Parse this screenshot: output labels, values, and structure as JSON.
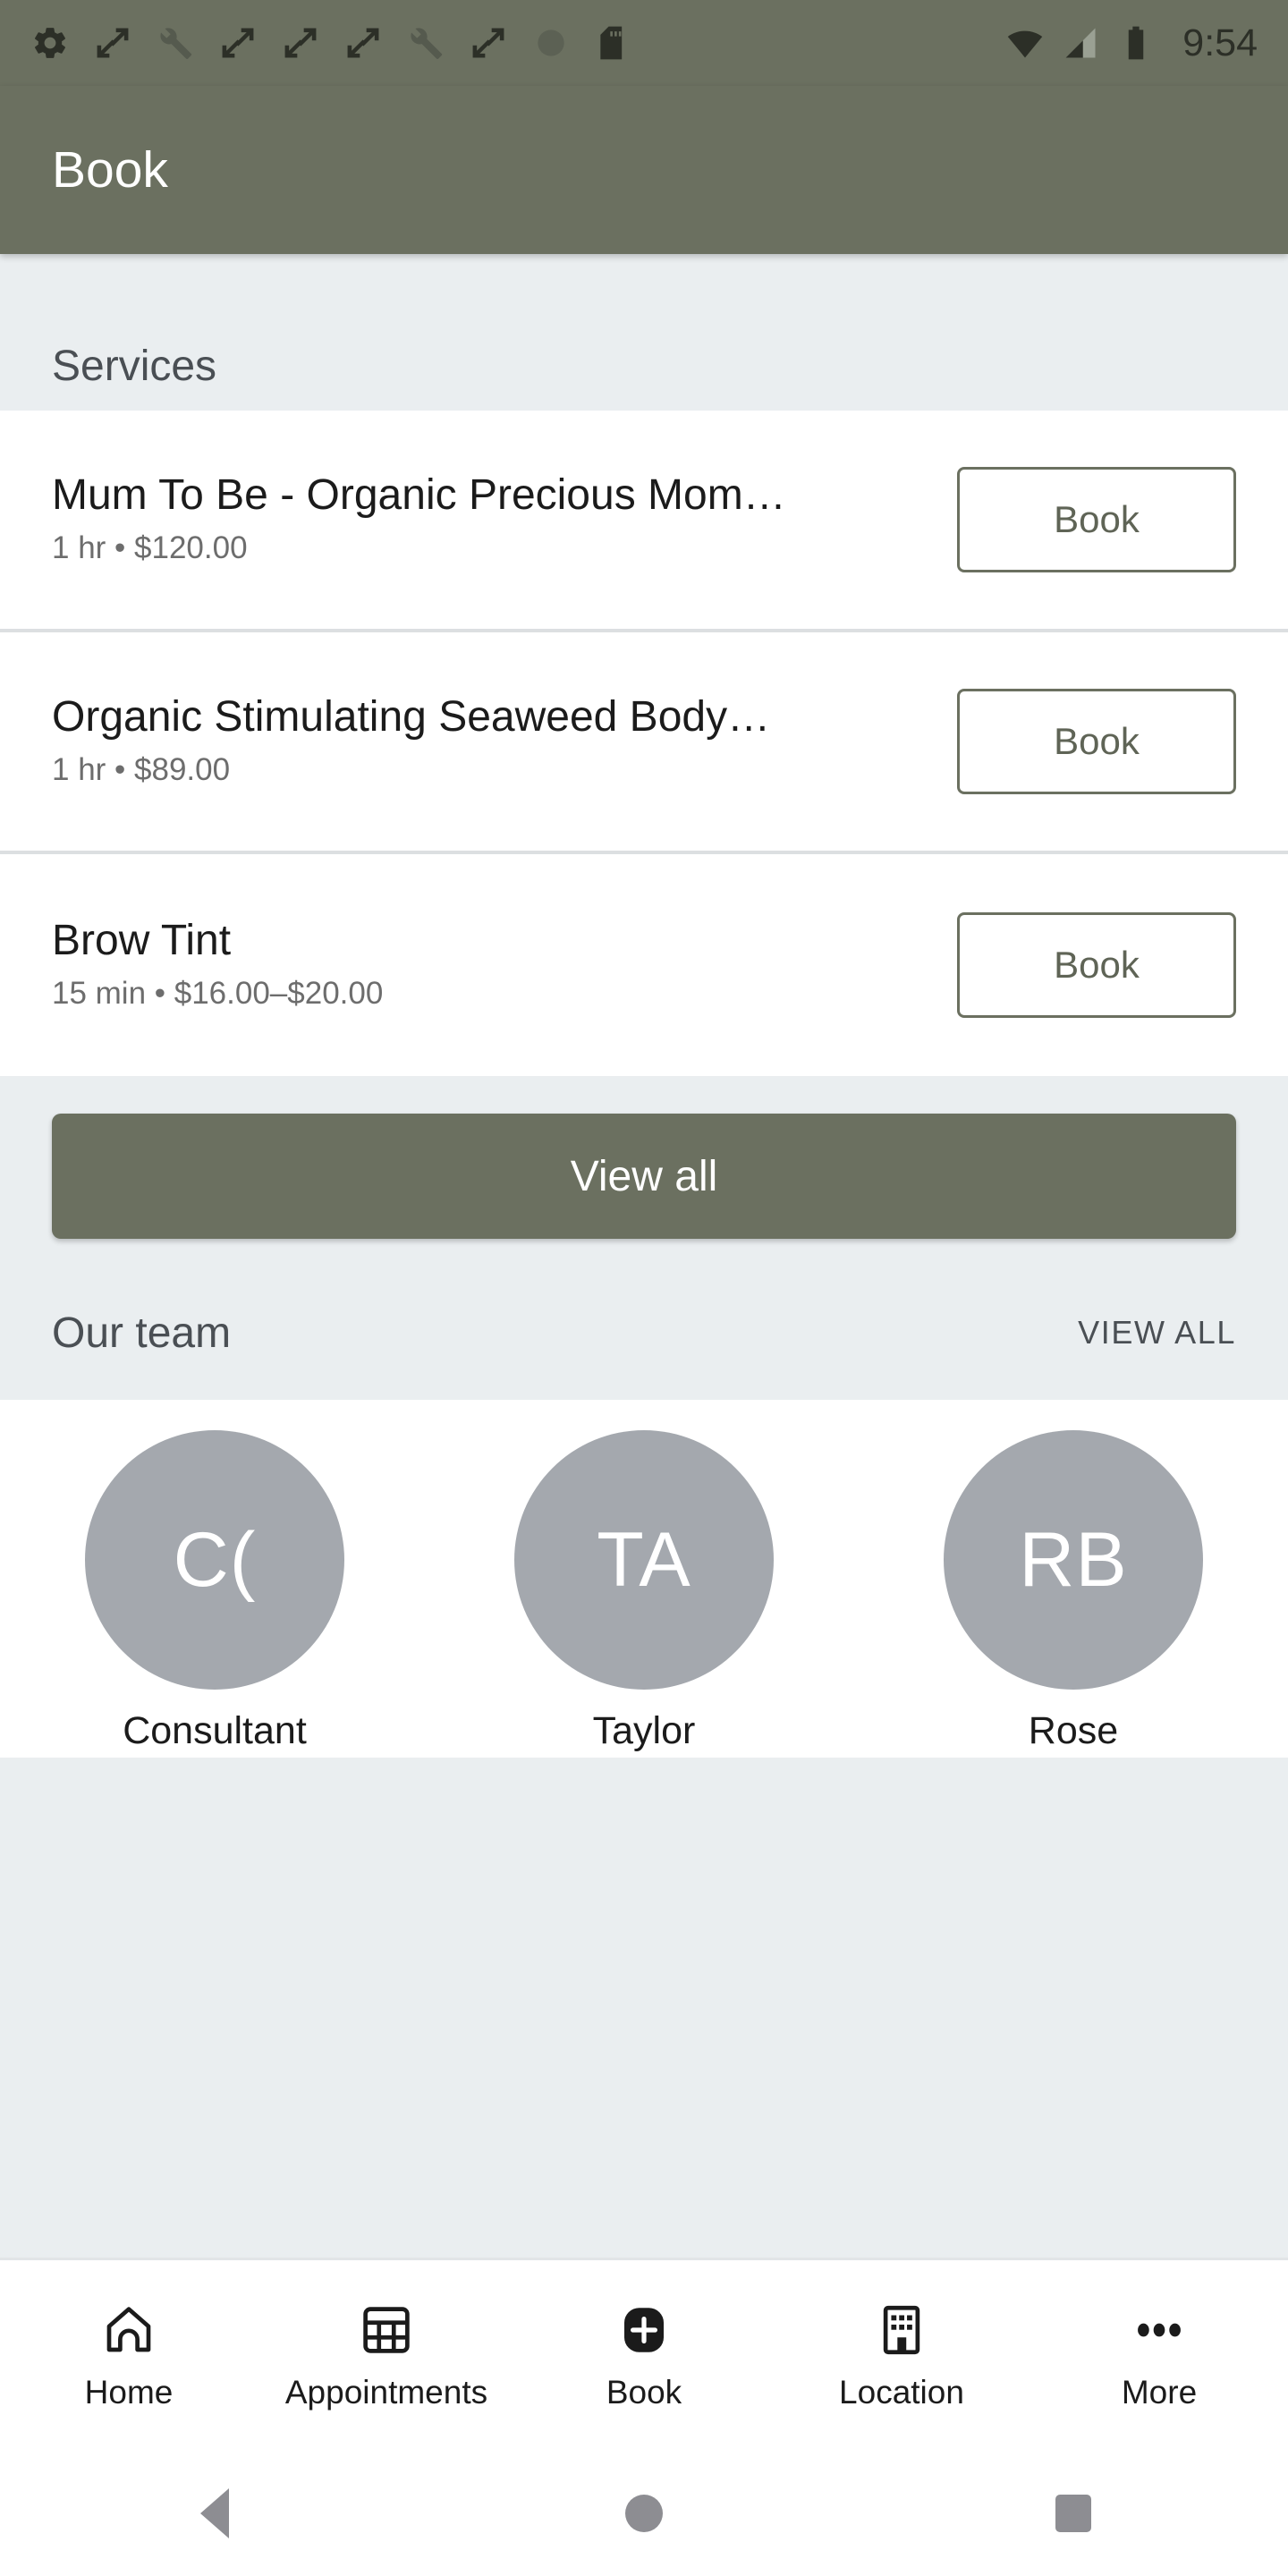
{
  "status_bar": {
    "time": "9:54",
    "notification_icons": [
      "gear-icon",
      "sync-icon",
      "wrench-icon",
      "sync-icon",
      "sync-icon",
      "sync-icon",
      "wrench-icon",
      "sync-icon",
      "circle-icon",
      "sd-card-icon"
    ],
    "system_icons": [
      "wifi-icon",
      "cellular-signal-icon",
      "battery-icon"
    ]
  },
  "app_bar": {
    "title": "Book"
  },
  "services_section": {
    "title": "Services",
    "items": [
      {
        "name": "Mum To Be - Organic Precious Mom…",
        "meta": "1 hr • $120.00",
        "button": "Book"
      },
      {
        "name": "Organic Stimulating Seaweed Body…",
        "meta": "1 hr • $89.00",
        "button": "Book"
      },
      {
        "name": "Brow Tint",
        "meta": "15 min • $16.00–$20.00",
        "button": "Book"
      }
    ],
    "view_all_button": "View all"
  },
  "team_section": {
    "title": "Our team",
    "view_all_link": "VIEW ALL",
    "members": [
      {
        "initials": "C(",
        "name": "Consultant"
      },
      {
        "initials": "TA",
        "name": "Taylor"
      },
      {
        "initials": "RB",
        "name": "Rose"
      }
    ]
  },
  "bottom_nav": {
    "items": [
      {
        "label": "Home",
        "icon": "home-icon"
      },
      {
        "label": "Appointments",
        "icon": "calendar-grid-icon"
      },
      {
        "label": "Book",
        "icon": "plus-square-icon"
      },
      {
        "label": "Location",
        "icon": "building-icon"
      },
      {
        "label": "More",
        "icon": "more-dots-icon"
      }
    ]
  },
  "android_nav": {
    "back": "back-button",
    "home": "home-button",
    "recents": "recents-button"
  },
  "colors": {
    "brand": "#6b7060",
    "page_bg": "#eaeef0",
    "card_bg": "#ffffff",
    "avatar_bg": "#a4a8ae",
    "divider": "#dcdfe1",
    "text_primary": "#1b1b1b",
    "text_secondary": "#6d6d6d"
  }
}
